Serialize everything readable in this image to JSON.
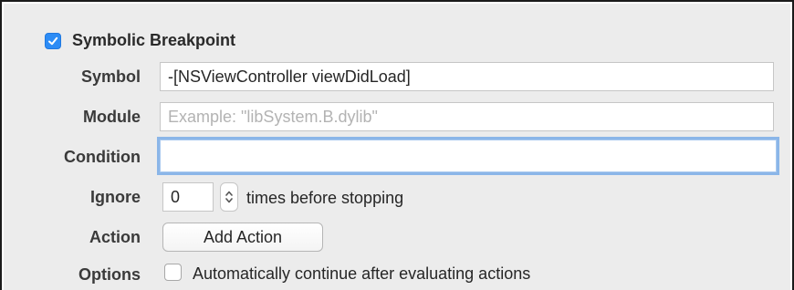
{
  "header": {
    "checked": true,
    "title": "Symbolic Breakpoint"
  },
  "symbol": {
    "label": "Symbol",
    "value": "-[NSViewController viewDidLoad]"
  },
  "module": {
    "label": "Module",
    "placeholder": "Example: \"libSystem.B.dylib\""
  },
  "condition": {
    "label": "Condition",
    "value": ""
  },
  "ignore": {
    "label": "Ignore",
    "value": "0",
    "suffix": "times before stopping"
  },
  "action": {
    "label": "Action",
    "button_label": "Add Action"
  },
  "options": {
    "label": "Options",
    "checked": false,
    "checkbox_label": "Automatically continue after evaluating actions"
  },
  "colors": {
    "accent": "#2d8cf5",
    "focus_ring": "#8bb6e8",
    "panel_bg": "#ececec"
  },
  "icons": [
    "checkmark-icon",
    "stepper-arrows-icon"
  ]
}
